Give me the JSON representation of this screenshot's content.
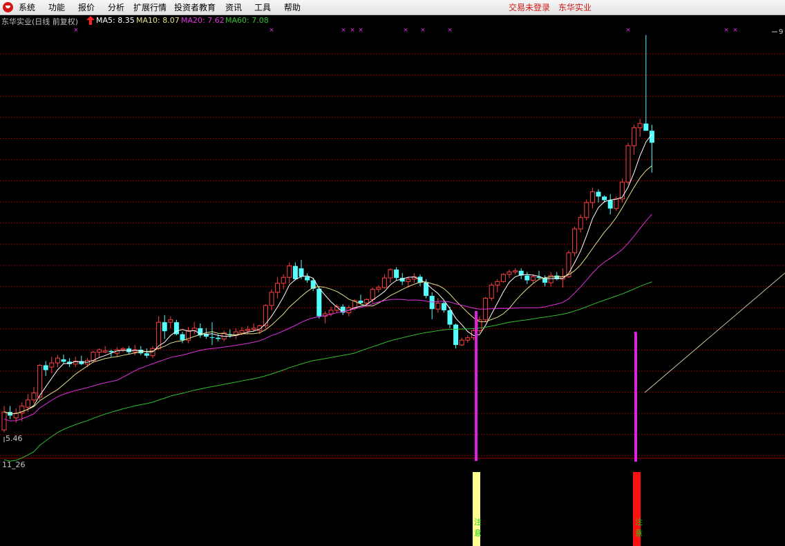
{
  "menu": {
    "items": [
      "系统",
      "功能",
      "报价",
      "分析",
      "扩展行情",
      "投资者教育",
      "资讯",
      "工具",
      "帮助"
    ],
    "login_status": "交易未登录",
    "stock_name": "东华实业"
  },
  "chart_header": {
    "title": "东华实业(日线 前复权)",
    "ma5": "MA5: 8.35",
    "ma10": "MA10: 8.07",
    "ma20": "MA20: 7.62",
    "ma60": "MA60: 7.08"
  },
  "colors": {
    "up": "#ff4040",
    "down": "#54ffff",
    "ma5": "#ffffff",
    "ma10": "#e8e08a",
    "ma20": "#e030e0",
    "ma60": "#30c030",
    "grid": "#8b0000",
    "signal_bar_1": "#ffff90",
    "signal_bar_2": "#ff1010",
    "signal_text": "#1ccc1c"
  },
  "price_labels": {
    "low": "5.46",
    "high": "9"
  },
  "sub_chart": {
    "label": "11_26",
    "signal_text": "注意"
  },
  "chart_data": {
    "type": "candlestick",
    "series_names": [
      "MA5",
      "MA10",
      "MA20",
      "MA60"
    ],
    "ohlc": [
      [
        5.5,
        5.9,
        5.46,
        5.8
      ],
      [
        5.8,
        5.9,
        5.68,
        5.74
      ],
      [
        5.7,
        5.86,
        5.62,
        5.78
      ],
      [
        5.78,
        5.96,
        5.64,
        5.9
      ],
      [
        5.88,
        6.1,
        5.8,
        6.0
      ],
      [
        6.0,
        6.22,
        5.94,
        6.12
      ],
      [
        6.05,
        6.6,
        6.0,
        6.58
      ],
      [
        6.58,
        6.65,
        6.4,
        6.5
      ],
      [
        6.55,
        6.72,
        6.45,
        6.62
      ],
      [
        6.62,
        6.75,
        6.55,
        6.7
      ],
      [
        6.68,
        6.76,
        6.6,
        6.64
      ],
      [
        6.64,
        6.7,
        6.55,
        6.6
      ],
      [
        6.6,
        6.72,
        6.55,
        6.65
      ],
      [
        6.65,
        6.74,
        6.58,
        6.6
      ],
      [
        6.6,
        6.7,
        6.55,
        6.66
      ],
      [
        6.66,
        6.82,
        6.62,
        6.8
      ],
      [
        6.8,
        6.86,
        6.7,
        6.84
      ],
      [
        6.8,
        6.9,
        6.78,
        6.82
      ],
      [
        6.82,
        6.84,
        6.72,
        6.8
      ],
      [
        6.78,
        6.88,
        6.72,
        6.84
      ],
      [
        6.84,
        6.88,
        6.8,
        6.86
      ],
      [
        6.86,
        6.9,
        6.76,
        6.8
      ],
      [
        6.8,
        6.92,
        6.75,
        6.84
      ],
      [
        6.84,
        6.9,
        6.75,
        6.78
      ],
      [
        6.78,
        6.86,
        6.7,
        6.74
      ],
      [
        6.74,
        6.9,
        6.7,
        6.86
      ],
      [
        6.86,
        7.4,
        6.84,
        7.3
      ],
      [
        7.3,
        7.42,
        7.02,
        7.15
      ],
      [
        7.3,
        7.4,
        7.2,
        7.34
      ],
      [
        7.3,
        7.34,
        7.08,
        7.1
      ],
      [
        7.1,
        7.14,
        6.95,
        7.0
      ],
      [
        7.0,
        7.22,
        6.95,
        7.16
      ],
      [
        7.16,
        7.3,
        7.1,
        7.2
      ],
      [
        7.2,
        7.28,
        7.04,
        7.08
      ],
      [
        7.1,
        7.2,
        7.02,
        7.06
      ],
      [
        7.05,
        7.3,
        6.92,
        7.04
      ],
      [
        7.04,
        7.1,
        6.98,
        7.02
      ],
      [
        7.02,
        7.16,
        6.98,
        7.12
      ],
      [
        7.1,
        7.18,
        7.04,
        7.08
      ],
      [
        7.08,
        7.2,
        7.02,
        7.14
      ],
      [
        7.12,
        7.22,
        7.08,
        7.16
      ],
      [
        7.16,
        7.24,
        7.1,
        7.18
      ],
      [
        7.18,
        7.28,
        7.14,
        7.2
      ],
      [
        7.16,
        7.26,
        7.1,
        7.24
      ],
      [
        7.24,
        7.6,
        7.2,
        7.58
      ],
      [
        7.58,
        7.85,
        7.5,
        7.8
      ],
      [
        7.8,
        8.05,
        7.7,
        7.95
      ],
      [
        7.95,
        8.1,
        7.85,
        8.05
      ],
      [
        8.05,
        8.3,
        7.95,
        8.24
      ],
      [
        8.24,
        8.3,
        8.0,
        8.02
      ],
      [
        8.2,
        8.34,
        8.02,
        8.06
      ],
      [
        8.06,
        8.12,
        7.96,
        8.0
      ],
      [
        8.0,
        8.04,
        7.82,
        7.86
      ],
      [
        7.86,
        7.9,
        7.36,
        7.4
      ],
      [
        7.4,
        7.48,
        7.28,
        7.44
      ],
      [
        7.44,
        7.56,
        7.4,
        7.5
      ],
      [
        7.5,
        7.6,
        7.46,
        7.56
      ],
      [
        7.56,
        7.6,
        7.42,
        7.46
      ],
      [
        7.46,
        7.58,
        7.4,
        7.54
      ],
      [
        7.54,
        7.68,
        7.5,
        7.66
      ],
      [
        7.66,
        7.76,
        7.6,
        7.62
      ],
      [
        7.62,
        7.7,
        7.56,
        7.68
      ],
      [
        7.68,
        7.88,
        7.62,
        7.85
      ],
      [
        7.85,
        7.92,
        7.8,
        7.88
      ],
      [
        7.88,
        8.1,
        7.86,
        8.04
      ],
      [
        8.04,
        8.2,
        7.96,
        8.18
      ],
      [
        8.18,
        8.22,
        8.0,
        8.04
      ],
      [
        8.04,
        8.12,
        7.92,
        7.98
      ],
      [
        7.98,
        8.06,
        7.88,
        8.02
      ],
      [
        8.02,
        8.12,
        7.96,
        8.06
      ],
      [
        8.06,
        8.1,
        7.9,
        7.96
      ],
      [
        7.96,
        8.02,
        7.7,
        7.74
      ],
      [
        7.74,
        7.8,
        7.35,
        7.52
      ],
      [
        7.52,
        7.7,
        7.46,
        7.62
      ],
      [
        7.62,
        7.66,
        7.46,
        7.5
      ],
      [
        7.5,
        7.56,
        7.2,
        7.26
      ],
      [
        7.26,
        7.28,
        6.86,
        6.92
      ],
      [
        6.92,
        7.04,
        6.9,
        7.0
      ],
      [
        7.0,
        7.08,
        6.96,
        7.04
      ],
      [
        7.04,
        7.2,
        7.0,
        7.16
      ],
      [
        7.16,
        7.4,
        7.12,
        7.34
      ],
      [
        7.34,
        7.72,
        7.3,
        7.7
      ],
      [
        7.7,
        7.96,
        7.66,
        7.92
      ],
      [
        7.92,
        8.02,
        7.8,
        7.98
      ],
      [
        7.98,
        8.12,
        7.96,
        8.1
      ],
      [
        8.1,
        8.18,
        8.04,
        8.14
      ],
      [
        8.14,
        8.2,
        8.1,
        8.16
      ],
      [
        8.16,
        8.2,
        8.02,
        8.08
      ],
      [
        8.08,
        8.14,
        7.94,
        8.0
      ],
      [
        8.0,
        8.1,
        7.96,
        8.06
      ],
      [
        8.06,
        8.16,
        8.02,
        8.04
      ],
      [
        8.04,
        8.08,
        7.9,
        7.96
      ],
      [
        7.96,
        8.14,
        7.9,
        8.08
      ],
      [
        8.08,
        8.14,
        8.0,
        8.02
      ],
      [
        8.02,
        8.2,
        7.88,
        8.06
      ],
      [
        8.06,
        8.5,
        8.04,
        8.46
      ],
      [
        8.46,
        8.9,
        8.4,
        8.86
      ],
      [
        8.86,
        9.1,
        8.8,
        9.05
      ],
      [
        9.05,
        9.35,
        9.0,
        9.3
      ],
      [
        9.3,
        9.55,
        9.2,
        9.48
      ],
      [
        9.48,
        9.52,
        9.3,
        9.4
      ],
      [
        9.4,
        9.42,
        9.3,
        9.34
      ],
      [
        9.34,
        9.44,
        9.1,
        9.2
      ],
      [
        9.2,
        9.4,
        9.16,
        9.36
      ],
      [
        9.36,
        9.7,
        9.3,
        9.64
      ],
      [
        9.64,
        10.3,
        9.6,
        10.25
      ],
      [
        10.25,
        10.6,
        10.1,
        10.55
      ],
      [
        10.55,
        10.7,
        10.4,
        10.62
      ],
      [
        10.62,
        12.1,
        10.5,
        10.5
      ],
      [
        10.5,
        10.6,
        9.8,
        10.3
      ]
    ],
    "ylim": [
      5.2,
      12.2
    ]
  }
}
